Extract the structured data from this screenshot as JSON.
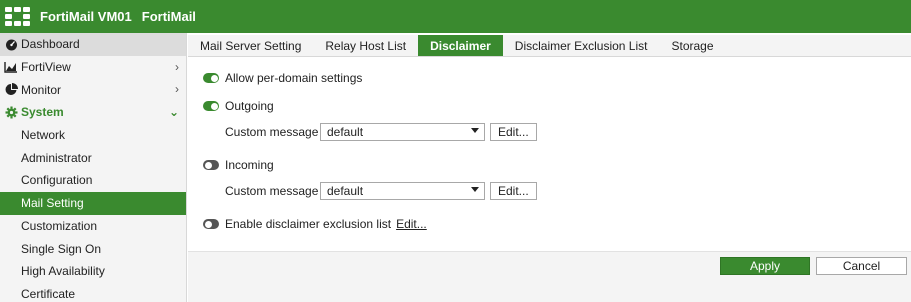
{
  "header": {
    "title": "FortiMail VM01",
    "subtitle": "FortiMail",
    "background": "#3a8a2f"
  },
  "sidebar": {
    "items": [
      {
        "label": "Dashboard",
        "icon": "dashboard-icon"
      },
      {
        "label": "FortiView",
        "icon": "chart-icon"
      },
      {
        "label": "Monitor",
        "icon": "pie-chart-icon"
      },
      {
        "label": "System",
        "icon": "gear-icon"
      },
      {
        "label": "Network"
      },
      {
        "label": "Administrator"
      },
      {
        "label": "Configuration"
      },
      {
        "label": "Mail Setting"
      },
      {
        "label": "Customization"
      },
      {
        "label": "Single Sign On"
      },
      {
        "label": "High Availability"
      },
      {
        "label": "Certificate"
      }
    ]
  },
  "tabs": [
    {
      "label": "Mail Server Setting"
    },
    {
      "label": "Relay Host List"
    },
    {
      "label": "Disclaimer"
    },
    {
      "label": "Disclaimer Exclusion List"
    },
    {
      "label": "Storage"
    }
  ],
  "form": {
    "allow_per_domain": {
      "label": "Allow per-domain settings",
      "enabled": true
    },
    "outgoing": {
      "label": "Outgoing",
      "enabled": true
    },
    "outgoing_custom_label": "Custom message",
    "outgoing_select_value": "default",
    "outgoing_edit_label": "Edit...",
    "incoming": {
      "label": "Incoming",
      "enabled": false
    },
    "incoming_custom_label": "Custom message",
    "incoming_select_value": "default",
    "incoming_edit_label": "Edit...",
    "exclusion": {
      "label": "Enable disclaimer exclusion list",
      "enabled": false
    },
    "exclusion_edit_label": "Edit..."
  },
  "footer": {
    "apply_label": "Apply",
    "cancel_label": "Cancel"
  },
  "colors": {
    "accent": "#3a8a2f",
    "toggle_off": "#555555"
  }
}
